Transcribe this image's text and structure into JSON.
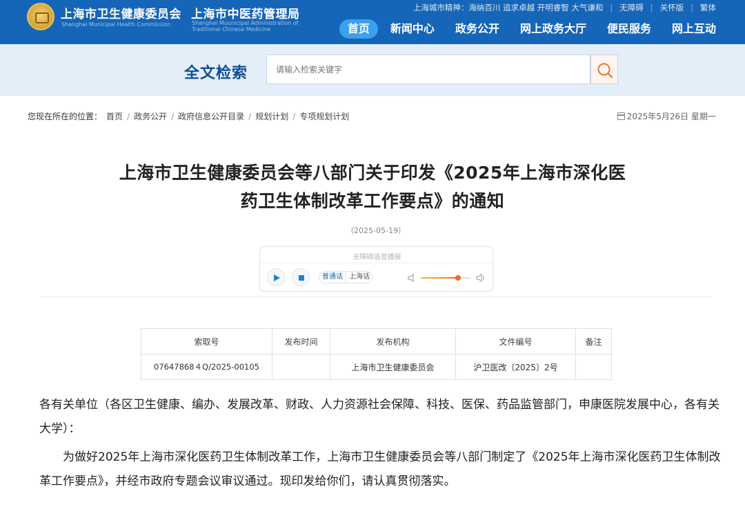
{
  "header": {
    "org_health_cn": "上海市卫生健康委员会",
    "org_health_en": "Shanghai Municipal Health Commission",
    "org_tcm_cn": "上海市中医药管理局",
    "org_tcm_en_line1": "Shanghai Muunicipal Administration of",
    "org_tcm_en_line2": "Traditional Chinese Medicine",
    "city_spirit": "上海城市精神：海纳百川 追求卓越 开明睿智 大气谦和",
    "accessibility_link": "无障碍",
    "care_mode_link": "关怀版",
    "traditional_link": "繁体",
    "nav": [
      {
        "label": "首页",
        "active": true
      },
      {
        "label": "新闻中心",
        "active": false
      },
      {
        "label": "政务公开",
        "active": false
      },
      {
        "label": "网上政务大厅",
        "active": false
      },
      {
        "label": "便民服务",
        "active": false
      },
      {
        "label": "网上互动",
        "active": false
      }
    ],
    "colors": {
      "header_bg": "#1565b8",
      "active_nav": "#39a1ee"
    }
  },
  "search": {
    "title": "全文检索",
    "placeholder": "请输入检索关键字",
    "button_icon": "search-icon"
  },
  "breadcrumb": {
    "lead": "您现在所在的位置：",
    "items": [
      "首页",
      "政务公开",
      "政府信息公开目录",
      "规划计划",
      "专项规划计划"
    ]
  },
  "today": "2025年5月26日 星期一",
  "article": {
    "title_line1": "上海市卫生健康委员会等八部门关于印发《2025年上海市深化医",
    "title_line2": "药卫生体制改革工作要点》的通知",
    "date": "（2025-05-19）",
    "paragraph1": "各有关单位（各区卫生健康、编办、发展改革、财政、人力资源社会保障、科技、医保、药品监管部门，申康医院发展中心，各有关大学）：",
    "paragraph2": "为做好2025年上海市深化医药卫生体制改革工作，上海市卫生健康委员会等八部门制定了《2025年上海市深化医药卫生体制改革工作要点》，并经市政府专题会议审议通过。现印发给你们，请认真贯彻落实。"
  },
  "player": {
    "label": "无障碍语音播报",
    "play_icon": "play-icon",
    "stop_icon": "stop-icon",
    "lang_options": [
      "普通话",
      "上海话"
    ],
    "selected_lang": "普通话",
    "volume": 0.75
  },
  "info_table": {
    "headers": [
      "索取号",
      "发布时间",
      "发布机构",
      "文件编号",
      "备注"
    ],
    "row": [
      "07647868４Q/2025-00105",
      "",
      "上海市卫生健康委员会",
      "沪卫医改〔2025〕2号",
      ""
    ]
  }
}
